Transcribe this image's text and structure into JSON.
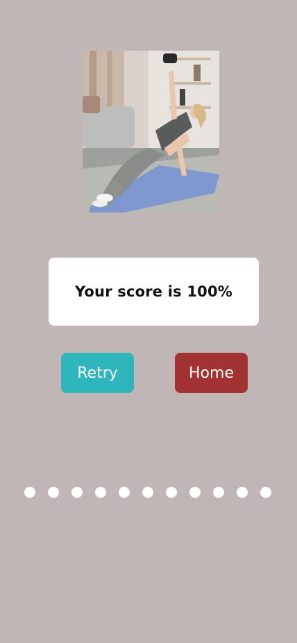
{
  "exercise_image": {
    "icon": "workout-photo"
  },
  "result": {
    "score_text": "Your score is 100%"
  },
  "actions": {
    "retry_label": "Retry",
    "home_label": "Home"
  },
  "pagination": {
    "count": 11
  },
  "colors": {
    "background": "#bfb6b5",
    "retry": "#2fb5bc",
    "home": "#a33232",
    "dots": "#ffffff"
  }
}
